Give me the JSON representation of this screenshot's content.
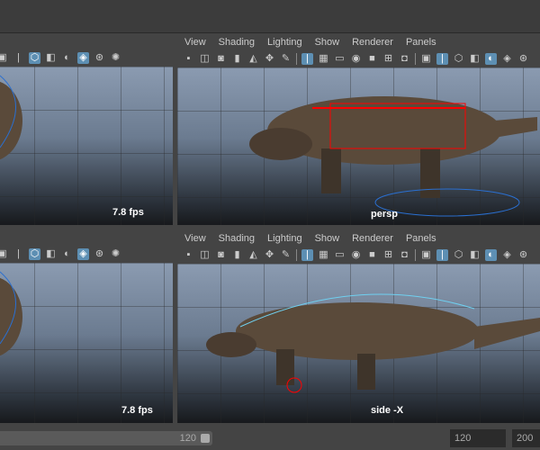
{
  "menu": [
    "View",
    "Shading",
    "Lighting",
    "Show",
    "Renderer",
    "Panels"
  ],
  "viewports": {
    "top_left": {
      "label": "7.8 fps"
    },
    "top_right": {
      "label": "persp"
    },
    "bottom_left": {
      "label": "7.8 fps"
    },
    "bottom_right": {
      "label": "side -X"
    }
  },
  "toolbar_icons": [
    "camera-icon",
    "camera-lock-icon",
    "camera-attributes-icon",
    "bookmark-icon",
    "image-plane-icon",
    "pivot-icon",
    "pencil-icon",
    "grid-icon",
    "film-gate-icon",
    "resolution-gate-icon",
    "gate-mask-icon",
    "field-chart-icon",
    "safe-action-icon",
    "safe-title-icon",
    "wireframe-icon",
    "smooth-shade-icon",
    "default-light-icon",
    "xray-icon",
    "textured-icon",
    "lights-icon",
    "shadow-icon"
  ],
  "timeline": {
    "range_end": "120",
    "end_time": "120",
    "max_time": "200"
  },
  "colors": {
    "accent": "#5d8fb3",
    "viewport_top": "#8b9bb1",
    "viewport_bottom": "#17191c"
  }
}
